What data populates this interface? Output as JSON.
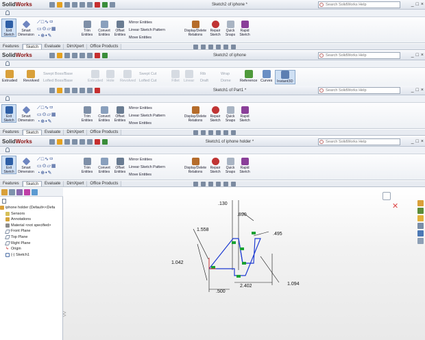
{
  "app": {
    "logo_bold": "Solid",
    "logo_rest": "Works",
    "search_placeholder": "Search SolidWorks Help",
    "window_buttons": [
      "_",
      "□",
      "×"
    ]
  },
  "windows": [
    {
      "title": "Sketch2 of iphone *"
    },
    {
      "title": "Sketch2 of iphone"
    },
    {
      "title": "Sketch1 of Part1 *"
    },
    {
      "title": "Sketch1 of iphone holder *"
    }
  ],
  "sketch_toolbar": {
    "exit_sketch": "Exit Sketch",
    "smart_dimension": "Smart Dimension",
    "trim_entities": "Trim Entities",
    "convert_entities": "Convert Entities",
    "offset_entities": "Offset Entities",
    "mirror_entities": "Mirror Entities",
    "linear_sketch_pattern": "Linear Sketch Pattern",
    "move_entities": "Move Entities",
    "display_delete_relations": "Display/Delete Relations",
    "repair_sketch": "Repair Sketch",
    "quick_snaps": "Quick Snaps",
    "rapid_sketch": "Rapid Sketch"
  },
  "tabs": [
    "Features",
    "Sketch",
    "Evaluate",
    "DimXpert",
    "Office Products"
  ],
  "active_tab": "Sketch",
  "features_toolbar": {
    "extruded": "Extruded",
    "revolved": "Revolved",
    "swept_boss": "Swept Boss/Base",
    "lofted_boss": "Lofted Boss/Base",
    "extruded_cut": "Extruded",
    "hole": "Hole",
    "revolved_cut": "Revolved",
    "swept_cut": "Swept Cut",
    "lofted_cut": "Lofted Cut",
    "fillet": "Fillet",
    "linear": "Linear",
    "rib": "Rib",
    "draft": "Draft",
    "wrap": "Wrap",
    "dome": "Dome",
    "reference": "Reference",
    "curves": "Curves",
    "instant3d": "Instant3D"
  },
  "tree": {
    "root": "iphone holder  (Default<<Defa",
    "items": [
      "Sensors",
      "Annotations",
      "Material <not specified>",
      "Front Plane",
      "Top Plane",
      "Right Plane",
      "Origin",
      "(-) Sketch1"
    ]
  },
  "dimensions": {
    "d130": ".130",
    "d890": ".890",
    "d495": ".495",
    "d1558": "1.558",
    "d1042": "1.042",
    "d500": ".500",
    "d2402": "2.402",
    "d1094": "1.094"
  }
}
